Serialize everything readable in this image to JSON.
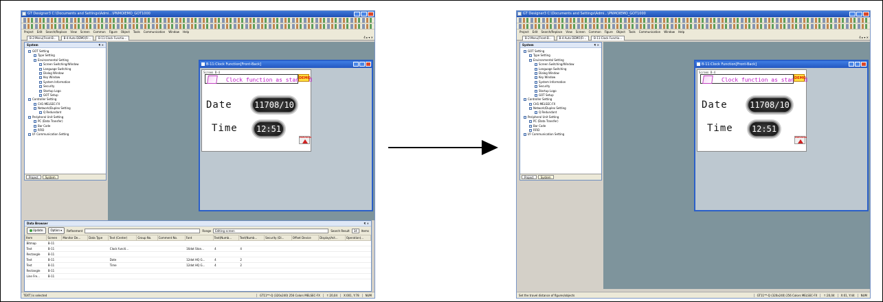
{
  "app": {
    "title": "GT Designer3 C:\\Documents and Settings\\Admi...\\PNMOIEMO_GOT1000",
    "menu": [
      "Project",
      "Edit",
      "Search/Replace",
      "View",
      "Screen",
      "Common",
      "Figure",
      "Object",
      "Tools",
      "Communication",
      "Window",
      "Help"
    ],
    "tabs": [
      "B-2:Menu[Front-B...",
      "B-4:Auto DEMO(Fr...",
      "B-11:Clock Functio..."
    ],
    "tab_controls": "4 ▸ ▾ ✕"
  },
  "system_panel": {
    "title": "System",
    "close": "₹ ✕",
    "tree": [
      {
        "label": "GOT Setting",
        "level": 1
      },
      {
        "label": "Type Setting",
        "level": 2
      },
      {
        "label": "Environmental Setting",
        "level": 2
      },
      {
        "label": "Screen Switching/Window",
        "level": 3
      },
      {
        "label": "Language Switching",
        "level": 3
      },
      {
        "label": "Dialog Window",
        "level": 3
      },
      {
        "label": "Key Window",
        "level": 3
      },
      {
        "label": "System Information",
        "level": 3
      },
      {
        "label": "Security",
        "level": 3
      },
      {
        "label": "Startup Logo",
        "level": 3
      },
      {
        "label": "GOT Setup",
        "level": 3
      },
      {
        "label": "Controller Setting",
        "level": 1
      },
      {
        "label": "CH1:MELSEC-FX",
        "level": 2
      },
      {
        "label": "Network/Duplex Setting",
        "level": 2
      },
      {
        "label": "Q Redundant",
        "level": 3
      },
      {
        "label": "Peripheral Unit Setting",
        "level": 1
      },
      {
        "label": "PC (Data Transfer)",
        "level": 2
      },
      {
        "label": "Bar Code",
        "level": 2
      },
      {
        "label": "RFID",
        "level": 2
      },
      {
        "label": "I/F Communication Setting",
        "level": 1
      }
    ],
    "tabs": [
      "Project",
      "System"
    ]
  },
  "screen_window": {
    "title": "B-11:Clock Function[Front-Back]",
    "screen_label": "Screen B-4",
    "header_text": "Clock function as standard",
    "demo_badge": "DEMO",
    "date_label": "Date",
    "date_value": "11708/10",
    "time_label": "Time",
    "time_value": "12:51",
    "corner_button_text": "PREVIOUS"
  },
  "data_browser": {
    "title": "Data Browser",
    "update_label": "Update",
    "option_label": "Option",
    "refinement_label": "Refinement",
    "range_label": "Range",
    "range_value": "Editing screen",
    "search_result_label": "Search Result",
    "search_result_value": "34",
    "items_label": "Items",
    "columns": [
      "Item",
      "Screen",
      "Monitor De...",
      "Data Type",
      "Text (Center)",
      "Group No.",
      "Comment No.",
      "Font",
      "Text(Numb...",
      "Text(Numb...",
      "Security (Di...",
      "Offset Device",
      "Display(Act...",
      "Operation(..."
    ],
    "rows": [
      [
        "Bitmap",
        "B-11",
        "",
        "",
        "",
        "",
        "",
        "",
        "",
        "",
        "",
        "",
        "",
        ""
      ],
      [
        "Text",
        "B-11",
        "",
        "",
        "Clock functi...",
        "",
        "",
        "16dot Stan...",
        "4",
        "4",
        "",
        "",
        "",
        ""
      ],
      [
        "Rectangle",
        "B-11",
        "",
        "",
        "",
        "",
        "",
        "",
        "",
        "",
        "",
        "",
        "",
        ""
      ],
      [
        "Text",
        "B-11",
        "",
        "",
        "Date",
        "",
        "",
        "12dot HQ G...",
        "4",
        "2",
        "",
        "",
        "",
        ""
      ],
      [
        "Text",
        "B-11",
        "",
        "",
        "Time",
        "",
        "",
        "12dot HQ G...",
        "4",
        "2",
        "",
        "",
        "",
        ""
      ],
      [
        "Rectangle",
        "B-11",
        "",
        "",
        "",
        "",
        "",
        "",
        "",
        "",
        "",
        "",
        "",
        ""
      ],
      [
        "Line Fre...",
        "B-11",
        "",
        "",
        "",
        "",
        "",
        "",
        "",
        "",
        "",
        "",
        "",
        ""
      ]
    ]
  },
  "status_left": {
    "message": "TEXT] is selected",
    "got_type": "GT11**-Q (320x240)  256 Colors  MELSEC-FX",
    "coords": "↑:20,04",
    "position": "X:001, Y:78",
    "num": "NUM"
  },
  "status_right": {
    "message": "Set the travel distance of figures/objects",
    "got_type": "GT11**-Q (320x240)  256 Colors  MELSEC-FX",
    "coords": "↑:20,04",
    "position": "X:01, Y:44",
    "num": "NUM"
  }
}
